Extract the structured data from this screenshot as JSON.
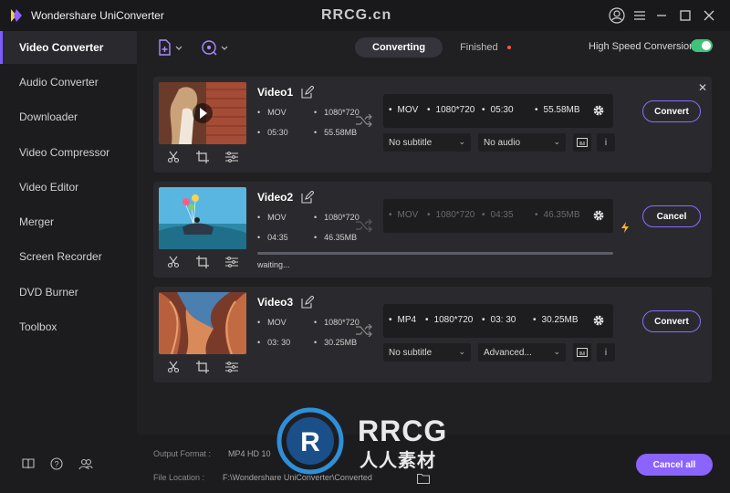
{
  "app": {
    "title": "Wondershare UniConverter",
    "watermark_top": "RRCG.cn",
    "accent_color": "#8b63ff"
  },
  "window_controls": [
    "user-icon",
    "menu-icon",
    "minimize-icon",
    "maximize-icon",
    "close-icon"
  ],
  "sidebar": {
    "items": [
      {
        "label": "Video Converter",
        "active": true
      },
      {
        "label": "Audio Converter"
      },
      {
        "label": "Downloader"
      },
      {
        "label": "Video Compressor"
      },
      {
        "label": "Video Editor"
      },
      {
        "label": "Merger"
      },
      {
        "label": "Screen Recorder"
      },
      {
        "label": "DVD Burner"
      },
      {
        "label": "Toolbox"
      }
    ],
    "bottom_icons": [
      "book-icon",
      "help-icon",
      "community-icon"
    ]
  },
  "toolbar": {
    "add_files_icon": "add-file-icon",
    "add_media_icon": "add-media-icon",
    "tabs": [
      {
        "label": "Converting",
        "active": true
      },
      {
        "label": "Finished"
      }
    ],
    "high_speed_label": "High Speed Conversion",
    "high_speed_on": true
  },
  "videos": [
    {
      "name": "Video1",
      "src_format": "MOV",
      "src_res": "1080*720",
      "src_dur": "05:30",
      "src_size": "55.58MB",
      "out_format": "MOV",
      "out_res": "1080*720",
      "out_dur": "05:30",
      "out_size": "55.58MB",
      "subtitle": "No subtitle",
      "audio": "No audio",
      "action": "Convert"
    },
    {
      "name": "Video2",
      "src_format": "MOV",
      "src_res": "1080*720",
      "src_dur": "04:35",
      "src_size": "46.35MB",
      "out_format": "MOV",
      "out_res": "1080*720",
      "out_dur": "04:35",
      "out_size": "46.35MB",
      "status": "waiting...",
      "progress": 1.0,
      "action": "Cancel"
    },
    {
      "name": "Video3",
      "src_format": "MOV",
      "src_res": "1080*720",
      "src_dur": "03: 30",
      "src_size": "30.25MB",
      "out_format": "MP4",
      "out_res": "1080*720",
      "out_dur": "03: 30",
      "out_size": "30.25MB",
      "subtitle": "No subtitle",
      "audio": "Advanced...",
      "action": "Convert"
    }
  ],
  "footer": {
    "output_format_label": "Output Format :",
    "output_format_value": "MP4 HD 10",
    "file_location_label": "File Location :",
    "file_location_value": "F:\\Wondershare UniConverter\\Converted",
    "cancel_all": "Cancel all"
  },
  "watermark": {
    "text1": "RRCG",
    "text2": "人人素材"
  }
}
